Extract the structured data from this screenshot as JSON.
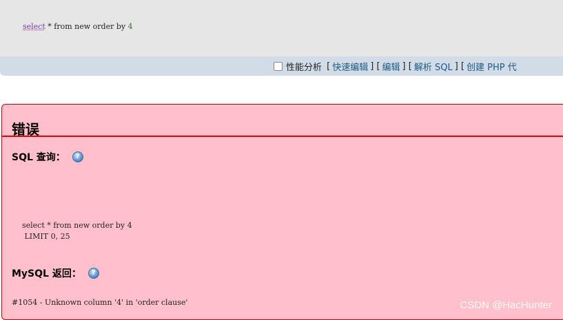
{
  "query_bar": {
    "sql_keyword": "select",
    "sql_rest": " * from new order by ",
    "sql_number": "4"
  },
  "toolbar": {
    "profiling_label": "性能分析",
    "links": [
      "快速编辑",
      "编辑",
      "解析 SQL",
      "创建 PHP 代"
    ]
  },
  "error": {
    "title": "错误",
    "sql_query_label": "SQL 查询：",
    "sql_query_text": "select * from new order by 4\n LIMIT 0, 25",
    "mysql_return_label": "MySQL 返回：",
    "mysql_return_text": "#1054 - Unknown column '4' in 'order clause'"
  },
  "watermark": "CSDN @HacHunter"
}
